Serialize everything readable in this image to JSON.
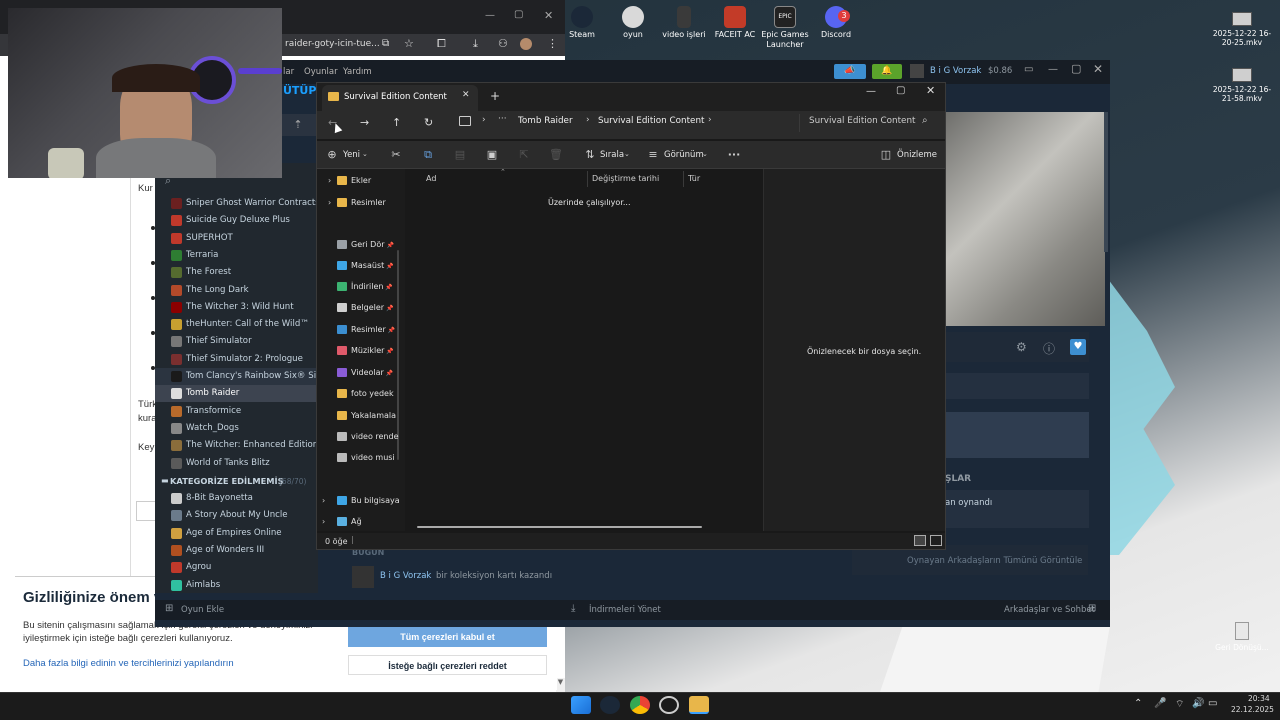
{
  "desktop": {
    "icons": [
      {
        "label": "Steam",
        "color": "#1b2838"
      },
      {
        "label": "oyun",
        "color": "#d9d9d9"
      },
      {
        "label": "video işleri",
        "color": "#3a3a3a"
      },
      {
        "label": "FACEIT AC",
        "color": "#c33b28"
      },
      {
        "label": "Epic Games Launcher",
        "color": "#222222"
      },
      {
        "label": "Discord",
        "color": "#5865f2",
        "badge": "3"
      }
    ],
    "files": [
      {
        "label": "2025-12-22 16-20-25.mkv"
      },
      {
        "label": "2025-12-22 16-21-58.mkv"
      }
    ],
    "recycle_bin": "Geri Dönüşü..."
  },
  "browser": {
    "url": "raider-goty-icin-tue...",
    "content_texts": [
      "Kur",
      "Türk",
      "kura",
      "Key"
    ]
  },
  "cookie_banner": {
    "title": "Gizliliğinize önem v",
    "text": "Bu sitenin çalışmasını sağlamak için gerekli çerezleri ve deneyiminizi iyileştirmek için isteğe bağlı çerezleri kullanıyoruz.",
    "link": "Daha fazla bilgi edinin ve tercihlerinizi yapılandırın",
    "accept": "Tüm çerezleri kabul et",
    "reject": "İsteğe bağlı çerezleri reddet"
  },
  "steam": {
    "menu": [
      "lar",
      "Oyunlar",
      "Yardım"
    ],
    "user": "B i G Vorzak",
    "balance": "$0.86",
    "library_partial_label": "ÜTÜPH",
    "games": [
      {
        "name": "Sniper Ghost Warrior Contracts",
        "color": "#6b2020"
      },
      {
        "name": "Suicide Guy Deluxe Plus",
        "color": "#c0392b"
      },
      {
        "name": "SUPERHOT",
        "color": "#c0392b"
      },
      {
        "name": "Terraria",
        "color": "#2e7d32"
      },
      {
        "name": "The Forest",
        "color": "#556b2f"
      },
      {
        "name": "The Long Dark",
        "color": "#b34a2a"
      },
      {
        "name": "The Witcher 3: Wild Hunt",
        "color": "#8b0000"
      },
      {
        "name": "theHunter: Call of the Wild™",
        "color": "#c8a030"
      },
      {
        "name": "Thief Simulator",
        "color": "#777777"
      },
      {
        "name": "Thief Simulator 2: Prologue",
        "color": "#7a2f2f"
      },
      {
        "name": "Tom Clancy's Rainbow Six® Siege",
        "color": "#1a1a1a"
      },
      {
        "name": "Tomb Raider",
        "color": "#dddddd"
      },
      {
        "name": "Transformice",
        "color": "#b86a2b"
      },
      {
        "name": "Watch_Dogs",
        "color": "#888888"
      },
      {
        "name": "The Witcher: Enhanced Edition",
        "color": "#8a6d3b"
      },
      {
        "name": "World of Tanks Blitz",
        "color": "#5a5a5a"
      }
    ],
    "category_label": "KATEGORİZE EDİLMEMİŞ",
    "category_count": "(68/70)",
    "uncat_games": [
      {
        "name": "8-Bit Bayonetta",
        "color": "#cccccc"
      },
      {
        "name": "A Story About My Uncle",
        "color": "#6b7b8b"
      },
      {
        "name": "Age of Empires Online",
        "color": "#d0a040"
      },
      {
        "name": "Age of Wonders III",
        "color": "#b05020"
      },
      {
        "name": "Agrou",
        "color": "#c0392b"
      },
      {
        "name": "Aimlabs",
        "color": "#30c0a0"
      }
    ],
    "right_section_label": "ŞLAR",
    "played_text": "an oynandı",
    "friends_link": "Oynayan Arkadaşların Tümünü Görüntüle",
    "today_label": "BUGÜN",
    "activity_user": "B i G Vorzak",
    "activity_text": "bir koleksiyon kartı kazandı",
    "bottom": {
      "add_game": "Oyun Ekle",
      "downloads": "İndirmeleri Yönet",
      "friends_chat": "Arkadaşlar ve Sohbet"
    }
  },
  "explorer": {
    "tab_title": "Survival Edition Content",
    "breadcrumb": [
      "Tomb Raider",
      "Survival Edition Content"
    ],
    "search_placeholder": "Survival Edition Content",
    "toolbar": {
      "new": "Yeni",
      "sort": "Sırala",
      "view": "Görünüm",
      "preview": "Önizleme"
    },
    "nav": [
      {
        "label": "Ekler",
        "kind": "folder"
      },
      {
        "label": "Resimler",
        "kind": "folder"
      },
      {
        "label": "Geri Dör",
        "kind": "pin",
        "color": "#9aa0a6"
      },
      {
        "label": "Masaüst",
        "kind": "pin",
        "color": "#3ea6e6"
      },
      {
        "label": "İndirilen",
        "kind": "pin",
        "color": "#3cb371"
      },
      {
        "label": "Belgeler",
        "kind": "pin",
        "color": "#cfcfcf"
      },
      {
        "label": "Resimler",
        "kind": "pin",
        "color": "#3b8ed0"
      },
      {
        "label": "Müzikler",
        "kind": "pin",
        "color": "#e05a6a"
      },
      {
        "label": "Videolar",
        "kind": "pin",
        "color": "#8a5cd6"
      },
      {
        "label": "foto yedek",
        "kind": "folder"
      },
      {
        "label": "Yakalamala",
        "kind": "folder"
      },
      {
        "label": "video rende",
        "kind": "drive"
      },
      {
        "label": "video musi",
        "kind": "drive"
      },
      {
        "label": "Bu bilgisaya",
        "kind": "pc"
      },
      {
        "label": "Ağ",
        "kind": "net"
      }
    ],
    "columns": [
      "Ad",
      "Değiştirme tarihi",
      "Tür"
    ],
    "working_text": "Üzerinde çalışılıyor...",
    "preview_text": "Önizlenecek bir dosya seçin.",
    "status": "0 öğe"
  },
  "taskbar": {
    "time": "20:34",
    "date": "22.12.2025"
  }
}
